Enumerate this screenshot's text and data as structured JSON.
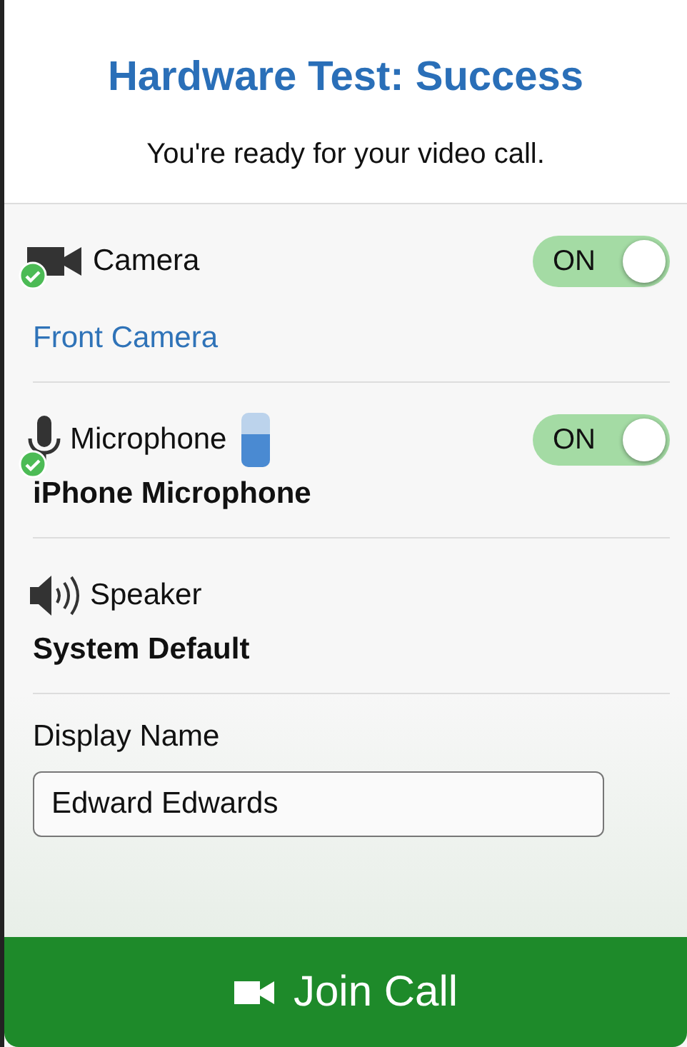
{
  "header": {
    "title": "Hardware Test: Success",
    "subtitle": "You're ready for your video call."
  },
  "devices": [
    {
      "kind": "camera",
      "label": "Camera",
      "verified": true,
      "toggle": {
        "text": "ON",
        "on": true
      },
      "device": {
        "text": "Front Camera",
        "kind": "link"
      }
    },
    {
      "kind": "microphone",
      "label": "Microphone",
      "verified": true,
      "level": 0.6,
      "toggle": {
        "text": "ON",
        "on": true
      },
      "device": {
        "text": "iPhone Microphone",
        "kind": "plain"
      }
    },
    {
      "kind": "speaker",
      "label": "Speaker",
      "verified": false,
      "device": {
        "text": "System Default",
        "kind": "plain"
      }
    }
  ],
  "display_name": {
    "label": "Display Name",
    "value": "Edward Edwards"
  },
  "join_button": {
    "label": "Join Call"
  }
}
